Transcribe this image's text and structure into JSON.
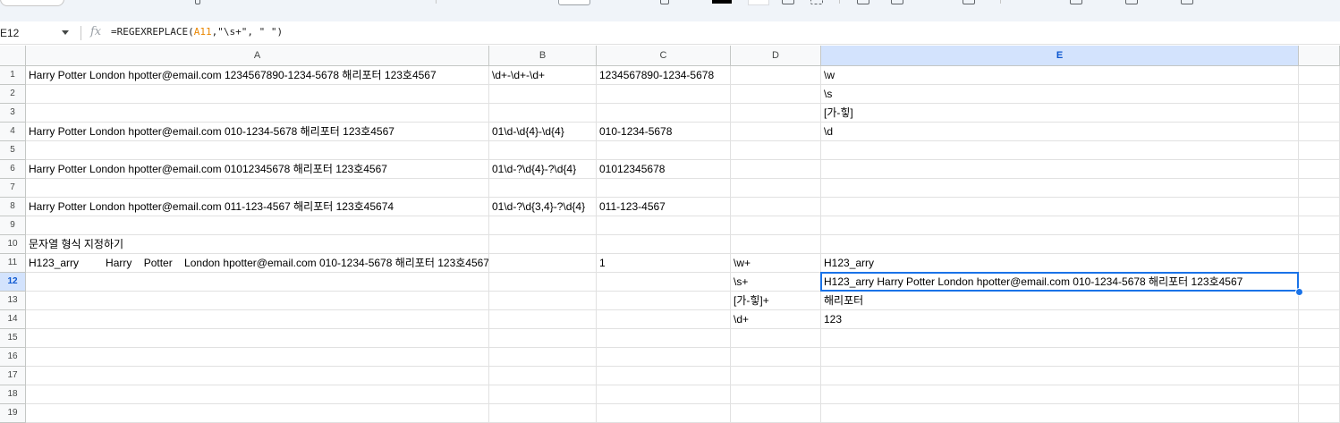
{
  "name_box": "E12",
  "formula": {
    "prefix": "=REGEXREPLACE(",
    "ref": "A11",
    "suffix": ",\"\\s+\", \" \")"
  },
  "columns": [
    "A",
    "B",
    "C",
    "D",
    "E"
  ],
  "selected_cell": {
    "row": 12,
    "col": "E"
  },
  "rows": [
    {
      "n": "1",
      "A": "Harry Potter London hpotter@email.com 1234567890-1234-5678 해리포터 123호4567",
      "B": "\\d+-\\d+-\\d+",
      "C": "1234567890-1234-5678",
      "D": "",
      "E": "\\w"
    },
    {
      "n": "2",
      "A": "",
      "B": "",
      "C": "",
      "D": "",
      "E": "\\s"
    },
    {
      "n": "3",
      "A": "",
      "B": "",
      "C": "",
      "D": "",
      "E": "[가-힣]"
    },
    {
      "n": "4",
      "A": "Harry Potter London hpotter@email.com 010-1234-5678 해리포터 123호4567",
      "B": "01\\d-\\d{4}-\\d{4}",
      "C": "010-1234-5678",
      "D": "",
      "E": "\\d"
    },
    {
      "n": "5",
      "A": "",
      "B": "",
      "C": "",
      "D": "",
      "E": ""
    },
    {
      "n": "6",
      "A": "Harry Potter London hpotter@email.com 01012345678 해리포터 123호4567",
      "B": "01\\d-?\\d{4}-?\\d{4}",
      "C": "01012345678",
      "D": "",
      "E": ""
    },
    {
      "n": "7",
      "A": "",
      "B": "",
      "C": "",
      "D": "",
      "E": ""
    },
    {
      "n": "8",
      "A": "Harry Potter London hpotter@email.com 011-123-4567 해리포터 123호45674",
      "B": "01\\d-?\\d{3,4}-?\\d{4}",
      "C": "011-123-4567",
      "D": "",
      "E": ""
    },
    {
      "n": "9",
      "A": "",
      "B": "",
      "C": "",
      "D": "",
      "E": ""
    },
    {
      "n": "10",
      "A": "문자열 형식 지정하기",
      "B": "",
      "C": "",
      "D": "",
      "E": ""
    },
    {
      "n": "11",
      "A": "H123_arry         Harry    Potter    London hpotter@email.com 010-1234-5678 해리포터 123호4567",
      "B": "",
      "C": "1",
      "D": "\\w+",
      "E": "H123_arry"
    },
    {
      "n": "12",
      "A": "",
      "B": "",
      "C": "",
      "D": "\\s+",
      "E": "H123_arry Harry Potter London hpotter@email.com 010-1234-5678 해리포터 123호4567"
    },
    {
      "n": "13",
      "A": "",
      "B": "",
      "C": "",
      "D": "[가-힣]+",
      "E": "해리포터"
    },
    {
      "n": "14",
      "A": "",
      "B": "",
      "C": "",
      "D": "\\d+",
      "E": "123"
    },
    {
      "n": "15",
      "A": "",
      "B": "",
      "C": "",
      "D": "",
      "E": ""
    },
    {
      "n": "16",
      "A": "",
      "B": "",
      "C": "",
      "D": "",
      "E": ""
    },
    {
      "n": "17",
      "A": "",
      "B": "",
      "C": "",
      "D": "",
      "E": ""
    },
    {
      "n": "18",
      "A": "",
      "B": "",
      "C": "",
      "D": "",
      "E": ""
    },
    {
      "n": "19",
      "A": "",
      "B": "",
      "C": "",
      "D": "",
      "E": ""
    }
  ]
}
